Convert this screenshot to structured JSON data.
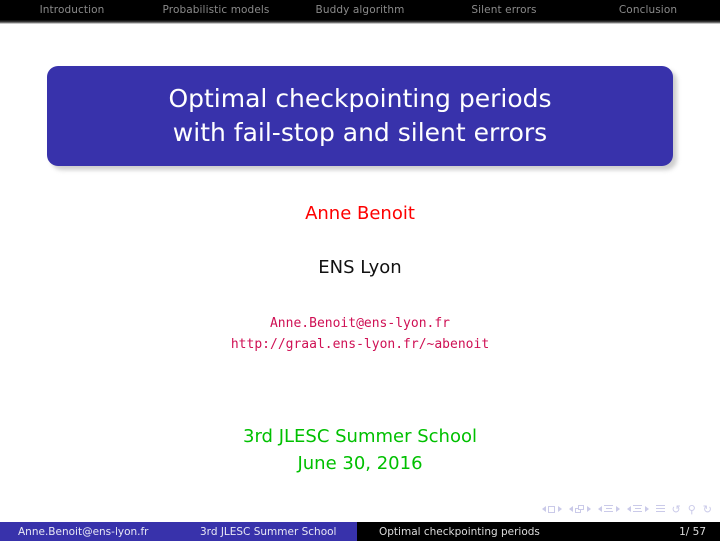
{
  "navbar": {
    "sections": [
      {
        "label": "Introduction"
      },
      {
        "label": "Probabilistic models"
      },
      {
        "label": "Buddy algorithm"
      },
      {
        "label": "Silent errors"
      },
      {
        "label": "Conclusion"
      }
    ]
  },
  "title": {
    "line1": "Optimal checkpointing periods",
    "line2": "with fail-stop and silent errors",
    "block_color": "#3832ab",
    "text_color": "#ffffff"
  },
  "author": {
    "name": "Anne Benoit",
    "color": "#fe0000"
  },
  "institute": {
    "name": "ENS Lyon",
    "color": "#111111"
  },
  "contact": {
    "email": "Anne.Benoit@ens-lyon.fr",
    "homepage": "http://graal.ens-lyon.fr/~abenoit",
    "color": "#cf1054"
  },
  "event": {
    "name": "3rd JLESC Summer School",
    "date": "June 30, 2016",
    "color": "#00c000"
  },
  "navsymbols": {
    "slide_icon": "slide-navigation-icon",
    "frame_icon": "frame-navigation-icon",
    "subsection_icon": "subsection-navigation-icon",
    "section_icon": "section-navigation-icon",
    "doc_icon": "document-navigation-icon",
    "back_icon": "↺",
    "search_icon": "⚲",
    "forward_icon": "↻"
  },
  "footer": {
    "author": "Anne.Benoit@ens-lyon.fr",
    "event": "3rd JLESC Summer School",
    "title": "Optimal checkpointing periods",
    "page": "1/ 57",
    "left_color": "#3832ab",
    "right_color": "#000000"
  }
}
